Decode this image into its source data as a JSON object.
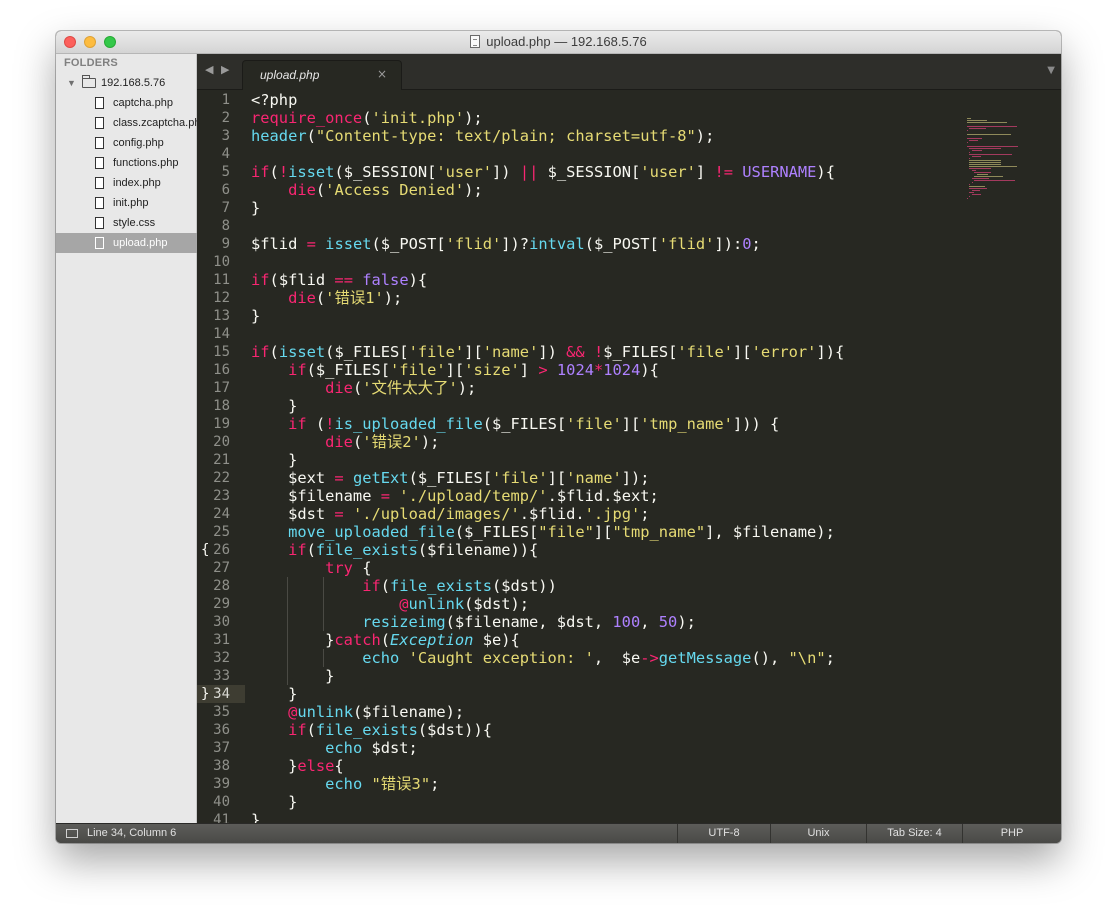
{
  "window": {
    "title": "upload.php — 192.168.5.76"
  },
  "sidebar": {
    "header": "FOLDERS",
    "root": "192.168.5.76",
    "files": [
      "captcha.php",
      "class.zcaptcha.php",
      "config.php",
      "functions.php",
      "index.php",
      "init.php",
      "style.css",
      "upload.php"
    ],
    "selected": "upload.php"
  },
  "tabs": [
    {
      "label": "upload.php",
      "close": "×"
    }
  ],
  "nav": {
    "back": "◀",
    "forward": "▶",
    "menu": "▼"
  },
  "editor": {
    "current_line": 34,
    "line_numbers": [
      "1",
      "2",
      "3",
      "4",
      "5",
      "6",
      "7",
      "8",
      "9",
      "10",
      "11",
      "12",
      "13",
      "14",
      "15",
      "16",
      "17",
      "18",
      "19",
      "20",
      "21",
      "22",
      "23",
      "24",
      "25",
      "26",
      "27",
      "28",
      "29",
      "30",
      "31",
      "32",
      "33",
      "34",
      "35",
      "36",
      "37",
      "38",
      "39",
      "40",
      "41"
    ],
    "fold_markers": {
      "26": "{",
      "34": "}"
    },
    "lines": [
      "<?php",
      "require_once('init.php');",
      "header(\"Content-type: text/plain; charset=utf-8\");",
      "",
      "if(!isset($_SESSION['user']) || $_SESSION['user'] != USERNAME){",
      "    die('Access Denied');",
      "}",
      "",
      "$flid = isset($_POST['flid'])?intval($_POST['flid']):0;",
      "",
      "if($flid == false){",
      "    die('错误1');",
      "}",
      "",
      "if(isset($_FILES['file']['name']) && !$_FILES['file']['error']){",
      "    if($_FILES['file']['size'] > 1024*1024){",
      "        die('文件太大了');",
      "    }",
      "    if (!is_uploaded_file($_FILES['file']['tmp_name'])) {",
      "        die('错误2');",
      "    }",
      "    $ext = getExt($_FILES['file']['name']);",
      "    $filename = './upload/temp/'.$flid.$ext;",
      "    $dst = './upload/images/'.$flid.'.jpg';",
      "    move_uploaded_file($_FILES[\"file\"][\"tmp_name\"], $filename);",
      "    if(file_exists($filename)){",
      "        try {",
      "            if(file_exists($dst))",
      "                @unlink($dst);",
      "            resizeimg($filename, $dst, 100, 50);",
      "        }catch(Exception $e){",
      "            echo 'Caught exception: ',  $e->getMessage(), \"\\n\";",
      "        }",
      "    }",
      "    @unlink($filename);",
      "    if(file_exists($dst)){",
      "        echo $dst;",
      "    }else{",
      "        echo \"错误3\";",
      "    }",
      "}"
    ]
  },
  "status_bar": {
    "position": "Line 34, Column 6",
    "encoding": "UTF-8",
    "line_endings": "Unix",
    "tab_size": "Tab Size: 4",
    "syntax": "PHP"
  },
  "colors": {
    "background": "#272822",
    "keyword": "#f92672",
    "function": "#66d9ef",
    "string": "#e6db74",
    "number": "#ae81ff",
    "text": "#f8f8f2",
    "line_number": "#8f908a"
  }
}
